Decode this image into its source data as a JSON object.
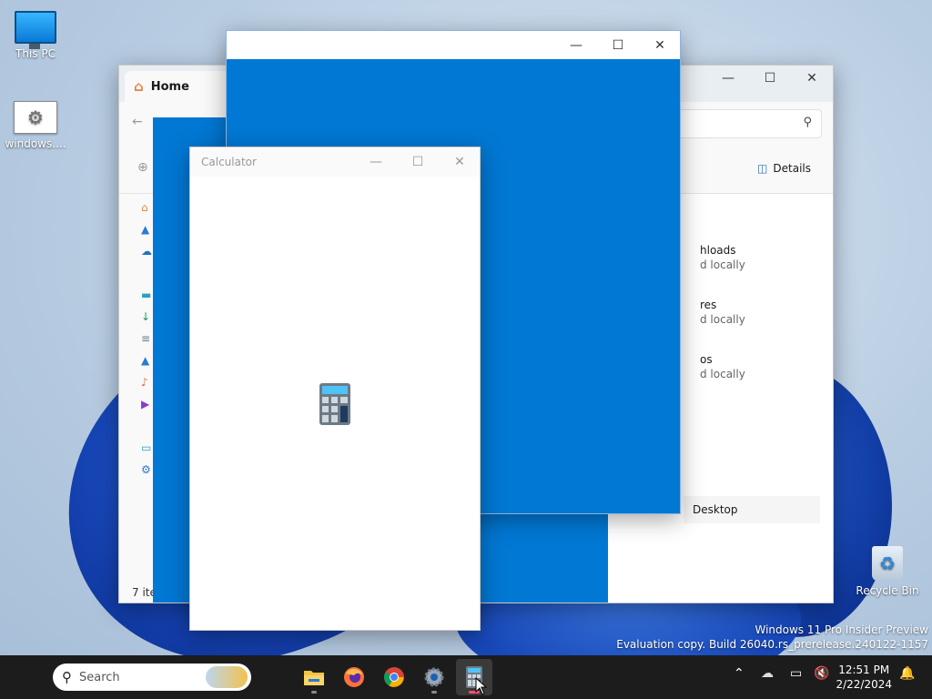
{
  "desktop": {
    "icons": [
      {
        "label": "This PC",
        "icon": "this-pc-icon"
      },
      {
        "label": "windows....",
        "icon": "settings-file-icon"
      },
      {
        "label": "Recycle Bin",
        "icon": "recycle-bin-icon"
      }
    ],
    "watermark": {
      "line1": "Windows 11 Pro Insider Preview",
      "line2": "Evaluation copy. Build 26040.rs_prerelease.240122-1157"
    }
  },
  "explorer": {
    "tab_label": "Home",
    "details_label": "Details",
    "quick_access": [
      {
        "name": "hloads",
        "status": "d locally"
      },
      {
        "name": "res",
        "status": "d locally"
      },
      {
        "name": "os",
        "status": "d locally"
      }
    ],
    "recent_item": "Desktop",
    "status_text": "7 ite"
  },
  "calculator": {
    "title": "Calculator"
  },
  "window_controls": {
    "minimize": "—",
    "maximize": "☐",
    "close": "✕"
  },
  "taskbar": {
    "search_label": "Search",
    "apps": [
      {
        "name": "file-explorer",
        "icon": "folder-icon",
        "active": false
      },
      {
        "name": "firefox",
        "icon": "firefox-icon",
        "active": false
      },
      {
        "name": "chrome",
        "icon": "chrome-icon",
        "active": false
      },
      {
        "name": "settings",
        "icon": "gear-icon",
        "active": false
      },
      {
        "name": "calculator",
        "icon": "calculator-icon",
        "active": true
      }
    ],
    "time": "12:51 PM",
    "date": "2/22/2024"
  },
  "colors": {
    "accent_blue": "#0078d4",
    "taskbar_bg": "#1c1c1c"
  }
}
